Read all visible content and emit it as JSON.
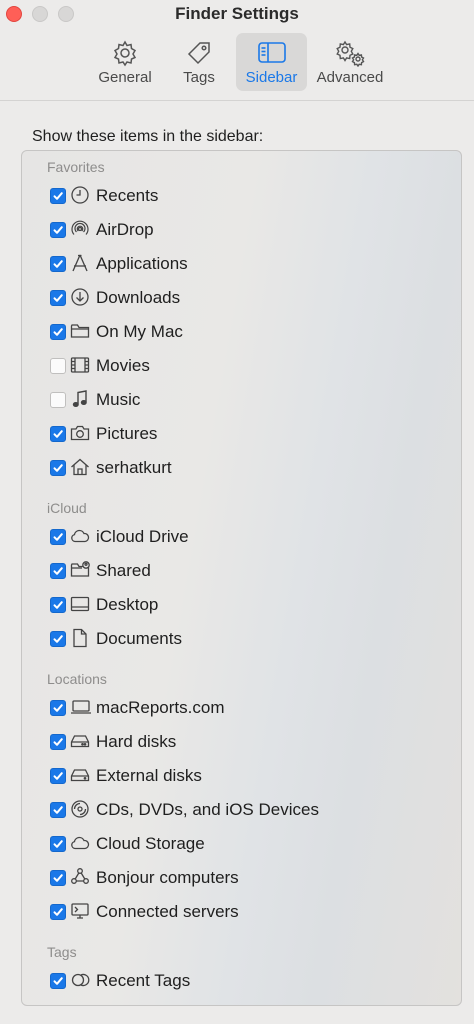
{
  "window": {
    "title": "Finder Settings"
  },
  "tabs": [
    {
      "label": "General",
      "icon": "gear-icon"
    },
    {
      "label": "Tags",
      "icon": "tag-icon"
    },
    {
      "label": "Sidebar",
      "icon": "sidebar-icon",
      "active": true
    },
    {
      "label": "Advanced",
      "icon": "gears-icon"
    }
  ],
  "content": {
    "heading": "Show these items in the sidebar:",
    "sections": {
      "favorites": "Favorites",
      "icloud": "iCloud",
      "locations": "Locations",
      "tags": "Tags"
    },
    "items": [
      {
        "label": "Recents",
        "checked": true,
        "icon": "clock-icon"
      },
      {
        "label": "AirDrop",
        "checked": true,
        "icon": "airdrop-icon"
      },
      {
        "label": "Applications",
        "checked": true,
        "icon": "applications-icon"
      },
      {
        "label": "Downloads",
        "checked": true,
        "icon": "download-icon"
      },
      {
        "label": "On My Mac",
        "checked": true,
        "icon": "folder-icon"
      },
      {
        "label": "Movies",
        "checked": false,
        "icon": "film-icon"
      },
      {
        "label": "Music",
        "checked": false,
        "icon": "music-note-icon"
      },
      {
        "label": "Pictures",
        "checked": true,
        "icon": "camera-icon"
      },
      {
        "label": "serhatkurt",
        "checked": true,
        "icon": "home-icon"
      },
      {
        "label": "iCloud Drive",
        "checked": true,
        "icon": "cloud-icon"
      },
      {
        "label": "Shared",
        "checked": true,
        "icon": "shared-folder-icon"
      },
      {
        "label": "Desktop",
        "checked": true,
        "icon": "desktop-icon"
      },
      {
        "label": "Documents",
        "checked": true,
        "icon": "document-icon"
      },
      {
        "label": "macReports.com",
        "checked": true,
        "icon": "laptop-icon"
      },
      {
        "label": "Hard disks",
        "checked": true,
        "icon": "hard-disk-icon"
      },
      {
        "label": "External disks",
        "checked": true,
        "icon": "external-disk-icon"
      },
      {
        "label": "CDs, DVDs, and iOS Devices",
        "checked": true,
        "icon": "disc-icon"
      },
      {
        "label": "Cloud Storage",
        "checked": true,
        "icon": "cloud-icon"
      },
      {
        "label": "Bonjour computers",
        "checked": true,
        "icon": "bonjour-icon"
      },
      {
        "label": "Connected servers",
        "checked": true,
        "icon": "server-icon"
      },
      {
        "label": "Recent Tags",
        "checked": true,
        "icon": "tags-icon"
      }
    ]
  },
  "colors": {
    "accent": "#1a78e8",
    "close": "#ff5f57"
  }
}
